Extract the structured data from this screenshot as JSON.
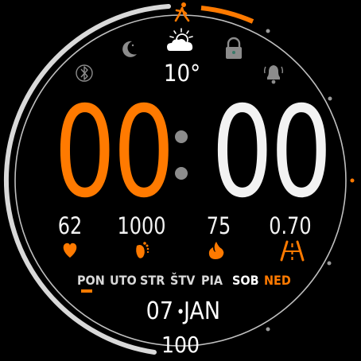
{
  "time": {
    "hours": "00",
    "minutes": "00"
  },
  "weather": {
    "temperature": "10°",
    "icon": "partly-cloudy-icon"
  },
  "status_icons": {
    "bluetooth": "bluetooth-icon",
    "night_mode": "moon-icon",
    "lock": "lock-icon",
    "alarm": "bell-icon",
    "activity": "walking-person-icon"
  },
  "stats": [
    {
      "name": "heart-rate",
      "value": "62",
      "icon": "heart-icon"
    },
    {
      "name": "steps",
      "value": "1000",
      "icon": "footprint-icon"
    },
    {
      "name": "calories",
      "value": "75",
      "icon": "flame-icon"
    },
    {
      "name": "distance",
      "value": "0.70",
      "icon": "road-icon"
    }
  ],
  "weekdays": [
    {
      "label": "PON",
      "active": true
    },
    {
      "label": "UTO",
      "active": false
    },
    {
      "label": "STR",
      "active": false
    },
    {
      "label": "ŠTV",
      "active": false
    },
    {
      "label": "PIA",
      "active": false
    },
    {
      "label": "SOB",
      "active": false
    },
    {
      "label": "NED",
      "active": false
    }
  ],
  "date": {
    "day": "07",
    "separator": "•",
    "month": "JAN"
  },
  "battery": {
    "value": "100",
    "level": 1.0
  },
  "colors": {
    "accent": "#ff7a00",
    "minutes": "#f2f2f2",
    "ring": "#d9d9d9",
    "dim_icon": "#8c8c8c",
    "sunday": "#ff7a00",
    "saturday": "#ffffff"
  },
  "activity_progress": 0.12
}
